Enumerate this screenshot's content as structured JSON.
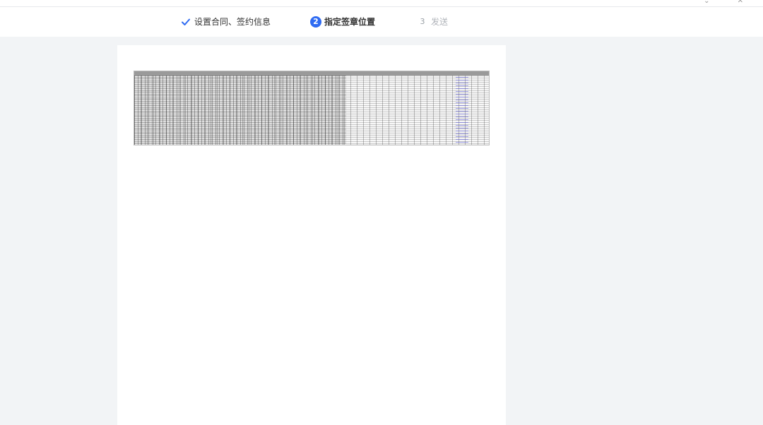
{
  "steps": [
    {
      "icon": "check-icon",
      "label": "设置合同、签约信息",
      "state": "done"
    },
    {
      "number": "2",
      "label": "指定签章位置",
      "state": "active"
    },
    {
      "number": "3",
      "label": "发送",
      "state": "pending"
    }
  ],
  "colors": {
    "accent": "#2f6bf2",
    "background": "#f2f4f6",
    "page": "#ffffff",
    "pending_text": "#b0b4ba"
  }
}
